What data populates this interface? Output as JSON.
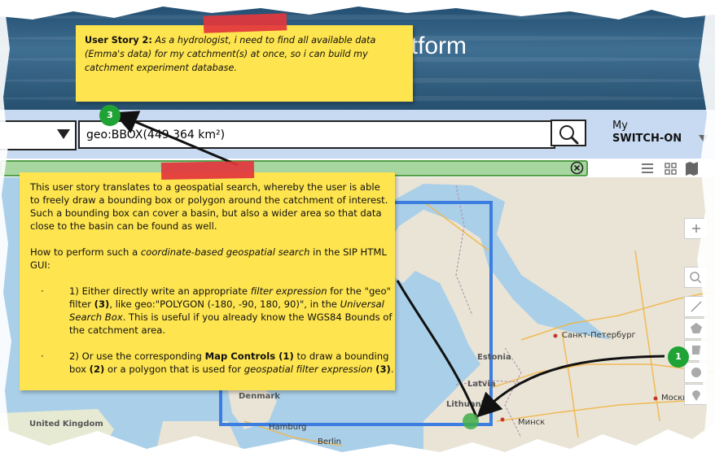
{
  "header": {
    "title_fragment": "atform"
  },
  "searchbar": {
    "dropdown_value": "",
    "query_value": "geo:BBOX(449.364 km²)",
    "search_icon": "magnifier-icon"
  },
  "user_menu": {
    "line1": "My",
    "line2": "SWITCH-ON"
  },
  "filterbar": {
    "clear_icon": "circle-x-icon",
    "view_icons": [
      "list-view-icon",
      "grid-view-icon",
      "map-view-icon"
    ]
  },
  "map": {
    "controls": [
      "zoom-in-icon",
      "search-icon",
      "draw-line-icon",
      "draw-polygon-icon",
      "draw-box-icon",
      "draw-circle-icon",
      "marker-icon"
    ],
    "countries": [
      "Estonia",
      "Latvia",
      "Lithuania",
      "Denmark",
      "United Kingdom"
    ],
    "cities": [
      "Санкт-Петербург",
      "Москва",
      "Минск",
      "Hamburg",
      "Berlin"
    ],
    "selection_color": "#3c7de0"
  },
  "notes": {
    "story": {
      "heading": "User Story 2:",
      "body": "As a hydrologist, i need to find all available data (Emma's data) for my catchment(s) at once, so i can build my catchment experiment database."
    },
    "explanation": {
      "intro": "This user story translates to a geospatial search, whereby the user is able to freely draw a bounding box or polygon around the catchment of interest. Such a bounding box can cover a basin, but also a wider area so that data close to the basin can be found as well.",
      "howto_prefix": "How to perform such a ",
      "howto_emph": "coordinate-based geospatial search",
      "howto_suffix": " in the SIP HTML GUI:",
      "bullet_dot": "·",
      "bullet1": {
        "a": "1) Either directly write an appropriate ",
        "b": "filter expression",
        "c": " for the \"geo\" filter ",
        "d": "(3)",
        "e": ", like geo:\"POLYGON (-180, -90, 180, 90)\", in the ",
        "f": "Universal Search Box",
        "g": ". This is  useful if you already know the WGS84 Bounds of the catchment area."
      },
      "bullet2": {
        "a": "2) Or use the corresponding  ",
        "b": "Map Controls (1)",
        "c": " to draw a bounding box ",
        "d": "(2)",
        "e": " or a polygon that is used for ",
        "f": "geospatial filter expression",
        "g": " ",
        "h": "(3)",
        "i": "."
      }
    }
  },
  "badges": {
    "b1": "1",
    "b3": "3"
  },
  "colors": {
    "note_yellow": "#fee44e",
    "tape_red": "#e2363c",
    "badge_green": "#1fa335",
    "filter_green": "#a8d6a0"
  }
}
